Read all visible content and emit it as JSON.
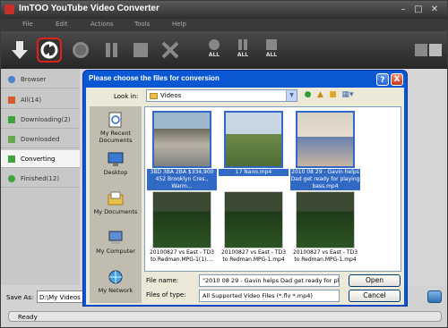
{
  "window": {
    "title": "ImTOO YouTube Video Converter"
  },
  "menu": [
    "File",
    "Edit",
    "Actions",
    "Tools",
    "Help"
  ],
  "toolbar": {
    "all_label": "ALL"
  },
  "sidebar": {
    "items": [
      {
        "label": "Browser"
      },
      {
        "label": "All(14)"
      },
      {
        "label": "Downloading(2)"
      },
      {
        "label": "Downloaded"
      },
      {
        "label": "Converting"
      },
      {
        "label": "Finished(12)"
      }
    ]
  },
  "bottom": {
    "save_as_label": "Save As:",
    "save_as_value": "D:\\My Videos",
    "status": "Ready"
  },
  "dialog": {
    "title": "Please choose the files for conversion",
    "help": "?",
    "close": "X",
    "look_in_label": "Look in:",
    "look_in_value": "Videos",
    "places": [
      {
        "label": "My Recent Documents"
      },
      {
        "label": "Desktop"
      },
      {
        "label": "My Documents"
      },
      {
        "label": "My Computer"
      },
      {
        "label": "My Network"
      }
    ],
    "files": [
      {
        "name": "3BD 3BA 2BA $334,900 452 Brooklyn Cres., Warm...",
        "selected": true
      },
      {
        "name": "17 Nano.mp4",
        "selected": true
      },
      {
        "name": "2010 08 29 - Gavin helps Dad get ready for playing bass.mp4",
        "selected": true
      },
      {
        "name": "20100827 vs East - TD3 to Redman.MPG-1(1)....",
        "selected": false
      },
      {
        "name": "20100827 vs East - TD3 to Redman.MPG-1.mp4",
        "selected": false
      },
      {
        "name": "20100827 vs East - TD3 to Redman.MPG-1.mp4",
        "selected": false
      }
    ],
    "file_name_label": "File name:",
    "file_name_value": "\"2010 08 29 - Gavin helps Dad get ready for pl",
    "file_type_label": "Files of type:",
    "file_type_value": "All Supported Video Files (*.flv *.mp4)",
    "open_label": "Open",
    "cancel_label": "Cancel"
  }
}
